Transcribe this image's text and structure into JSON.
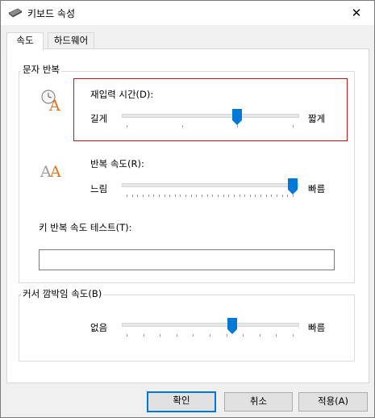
{
  "window": {
    "title": "키보드 속성",
    "close_glyph": "✕"
  },
  "tabs": [
    {
      "label": "속도",
      "selected": true
    },
    {
      "label": "하드웨어",
      "selected": false
    }
  ],
  "char_repeat": {
    "group_title": "문자 반복",
    "repeat_delay": {
      "label": "재입력 시간(D):",
      "min_label": "길게",
      "max_label": "짧게",
      "tick_count": 4,
      "value_fraction": 0.667
    },
    "repeat_rate": {
      "label": "반복 속도(R):",
      "min_label": "느림",
      "max_label": "빠름",
      "tick_count": 32,
      "value_fraction": 1.0
    },
    "test": {
      "label": "키 반복 속도 테스트(T):",
      "value": ""
    }
  },
  "cursor_blink": {
    "group_title": "커서 깜박임 속도(B)",
    "min_label": "없음",
    "max_label": "빠름",
    "tick_count": 11,
    "value_fraction": 0.636
  },
  "buttons": {
    "ok": "확인",
    "cancel": "취소",
    "apply": "적용(A)"
  },
  "colors": {
    "highlight_border": "#c4161c",
    "slider_thumb": "#0078d7",
    "default_button_border": "#0078d7"
  }
}
